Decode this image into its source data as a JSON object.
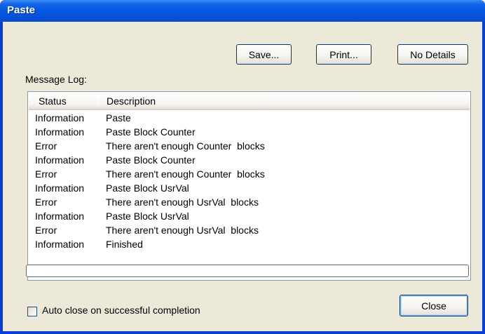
{
  "window": {
    "title": "Paste"
  },
  "toolbar": {
    "save_label": "Save...",
    "print_label": "Print...",
    "no_details_label": "No Details"
  },
  "message_log": {
    "label": "Message Log:",
    "columns": [
      "Status",
      "Description"
    ],
    "rows": [
      {
        "status": "Information",
        "description": "Paste"
      },
      {
        "status": "Information",
        "description": "Paste Block Counter"
      },
      {
        "status": "Error",
        "description": "There aren't enough Counter  blocks"
      },
      {
        "status": "Information",
        "description": "Paste Block Counter"
      },
      {
        "status": "Error",
        "description": "There aren't enough Counter  blocks"
      },
      {
        "status": "Information",
        "description": "Paste Block UsrVal"
      },
      {
        "status": "Error",
        "description": "There aren't enough UsrVal  blocks"
      },
      {
        "status": "Information",
        "description": "Paste Block UsrVal"
      },
      {
        "status": "Error",
        "description": "There aren't enough UsrVal  blocks"
      },
      {
        "status": "Information",
        "description": "Finished"
      }
    ]
  },
  "progress": {
    "value": 0
  },
  "footer": {
    "auto_close_label": "Auto close on successful completion",
    "auto_close_checked": false,
    "close_label": "Close"
  },
  "colors": {
    "titlebar": "#0558e2",
    "dialog_bg": "#ece9d8",
    "button_border": "#003c74"
  }
}
